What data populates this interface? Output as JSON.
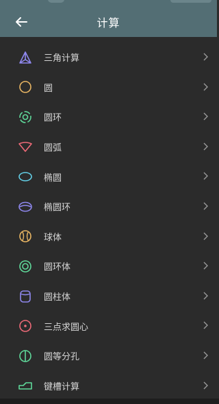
{
  "header": {
    "title": "计算"
  },
  "items": [
    {
      "label": "三角计算",
      "icon": "triangle-icon",
      "color": "#8f88ee"
    },
    {
      "label": "圆",
      "icon": "circle-icon",
      "color": "#e8b563"
    },
    {
      "label": "圆环",
      "icon": "ring-icon",
      "color": "#5fd99a"
    },
    {
      "label": "圆弧",
      "icon": "arc-icon",
      "color": "#ee6a78"
    },
    {
      "label": "椭圆",
      "icon": "ellipse-icon",
      "color": "#63cfe6"
    },
    {
      "label": "椭圆环",
      "icon": "elliptic-ring-icon",
      "color": "#8f88ee"
    },
    {
      "label": "球体",
      "icon": "sphere-icon",
      "color": "#e8b563"
    },
    {
      "label": "圆环体",
      "icon": "torus-icon",
      "color": "#5fd99a"
    },
    {
      "label": "圆柱体",
      "icon": "cylinder-icon",
      "color": "#8f88ee"
    },
    {
      "label": "三点求圆心",
      "icon": "three-point-circle-icon",
      "color": "#ee6a78"
    },
    {
      "label": "圆等分孔",
      "icon": "circle-division-icon",
      "color": "#5fd99a"
    },
    {
      "label": "键槽计算",
      "icon": "keyway-icon",
      "color": "#5fd99a"
    }
  ]
}
